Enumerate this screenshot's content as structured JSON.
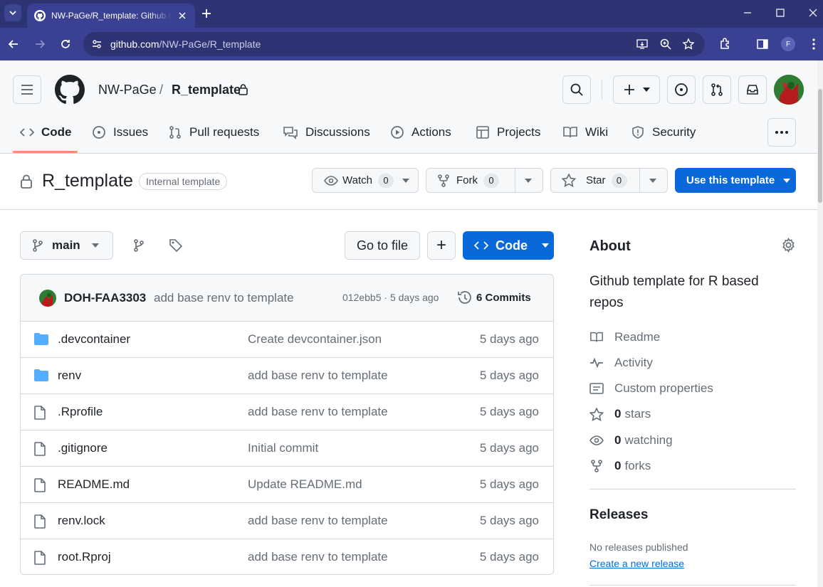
{
  "browser": {
    "tab_title": "NW-PaGe/R_template: Github t",
    "url_host": "github.com",
    "url_path": "/NW-PaGe/R_template",
    "profile_initial": "F"
  },
  "header": {
    "owner": "NW-PaGe",
    "separator": "/",
    "repo": "R_template"
  },
  "repo_nav": {
    "code": "Code",
    "issues": "Issues",
    "pulls": "Pull requests",
    "discussions": "Discussions",
    "actions": "Actions",
    "projects": "Projects",
    "wiki": "Wiki",
    "security": "Security"
  },
  "title_row": {
    "name": "R_template",
    "badge": "Internal template",
    "watch_label": "Watch",
    "watch_count": "0",
    "fork_label": "Fork",
    "fork_count": "0",
    "star_label": "Star",
    "star_count": "0",
    "use_template": "Use this template"
  },
  "file_toolbar": {
    "branch": "main",
    "go_to_file": "Go to file",
    "add": "+",
    "code": "Code"
  },
  "latest_commit": {
    "author": "DOH-FAA3303",
    "message": "add base renv to template",
    "sha_and_time": "012ebb5 · 5 days ago",
    "commits": "6 Commits"
  },
  "files": [
    {
      "name": ".devcontainer",
      "type": "folder",
      "message": "Create devcontainer.json",
      "date": "5 days ago"
    },
    {
      "name": "renv",
      "type": "folder",
      "message": "add base renv to template",
      "date": "5 days ago"
    },
    {
      "name": ".Rprofile",
      "type": "file",
      "message": "add base renv to template",
      "date": "5 days ago"
    },
    {
      "name": ".gitignore",
      "type": "file",
      "message": "Initial commit",
      "date": "5 days ago"
    },
    {
      "name": "README.md",
      "type": "file",
      "message": "Update README.md",
      "date": "5 days ago"
    },
    {
      "name": "renv.lock",
      "type": "file",
      "message": "add base renv to template",
      "date": "5 days ago"
    },
    {
      "name": "root.Rproj",
      "type": "file",
      "message": "add base renv to template",
      "date": "5 days ago"
    }
  ],
  "about": {
    "title": "About",
    "description": "Github template for R based repos",
    "readme": "Readme",
    "activity": "Activity",
    "custom_properties": "Custom properties",
    "stars_count": "0",
    "stars_label": "stars",
    "watching_count": "0",
    "watching_label": "watching",
    "forks_count": "0",
    "forks_label": "forks"
  },
  "releases": {
    "title": "Releases",
    "none": "No releases published",
    "create": "Create a new release"
  },
  "colors": {
    "accent_blue": "#0969da",
    "folder_blue": "#54aeff",
    "nav_underline": "#fd8c73",
    "browser_frame": "#2d3473"
  }
}
